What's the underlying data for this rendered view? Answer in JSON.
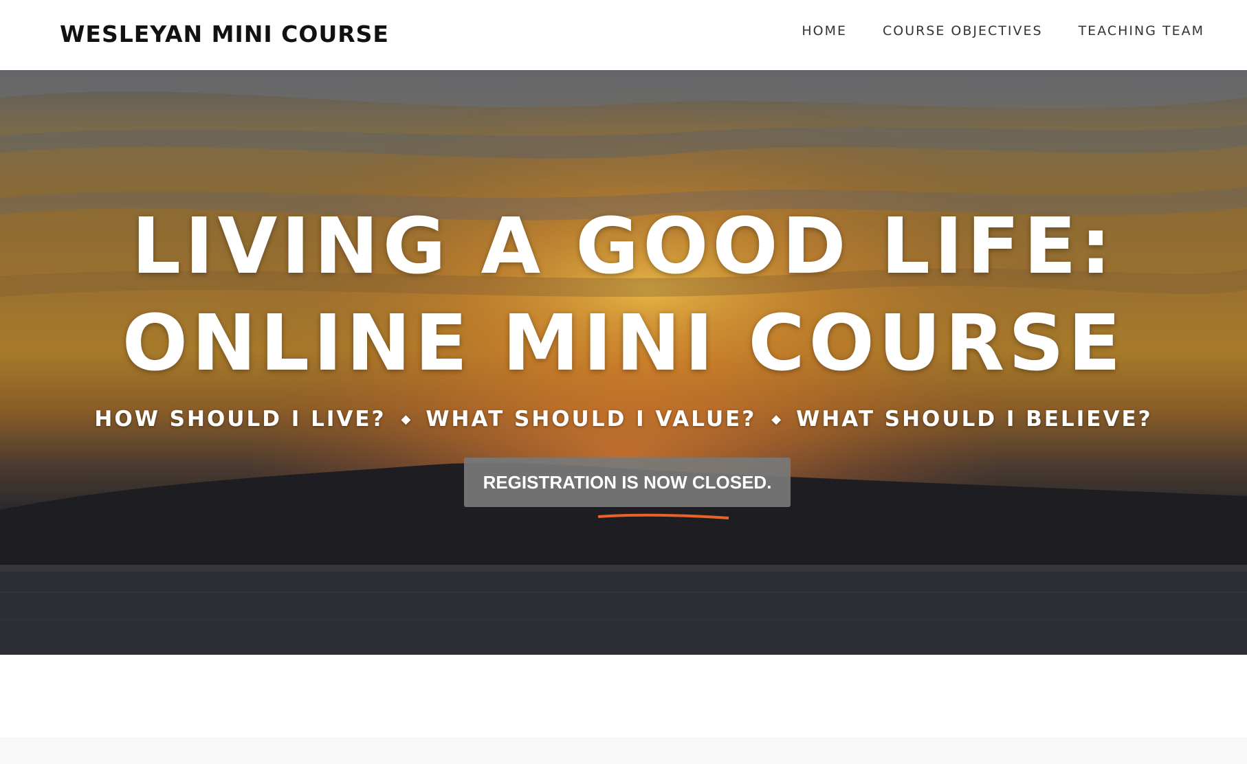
{
  "navbar": {
    "brand": "WESLEYAN MINI COURSE",
    "links": [
      {
        "label": "HOME"
      },
      {
        "label": "COURSE OBJECTIVES"
      },
      {
        "label": "TEACHING TEAM"
      }
    ]
  },
  "hero": {
    "title_line1": "LIVING A GOOD LIFE:",
    "title_line2": "ONLINE MINI COURSE",
    "questions": [
      "HOW SHOULD I LIVE?",
      "WHAT SHOULD I VALUE?",
      "WHAT SHOULD I BELIEVE?"
    ],
    "separator_icon": "diamond-icon",
    "registration_button": "REGISTRATION IS NOW CLOSED.",
    "background": "sunset-over-water-photo"
  },
  "colors": {
    "nav_text": "#333333",
    "brand_text": "#111111",
    "hero_text": "#ffffff",
    "button_bg": "#787878",
    "footer_bg": "#f7f8f7"
  }
}
